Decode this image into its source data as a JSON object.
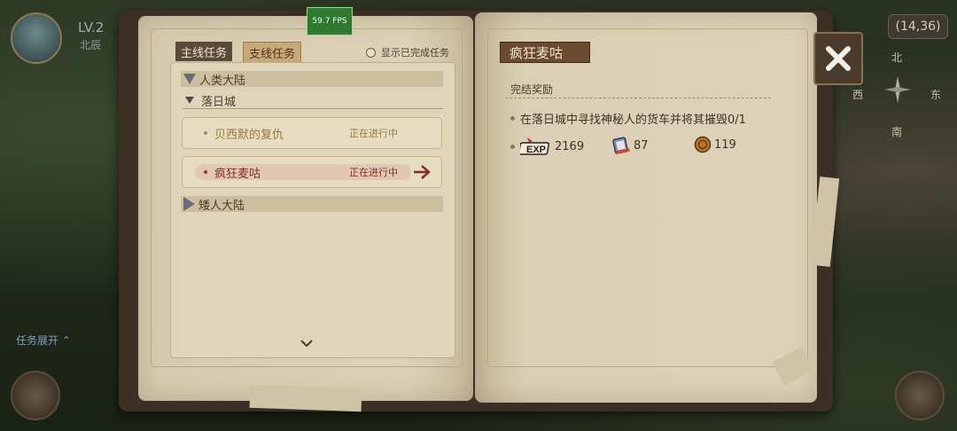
{
  "hud": {
    "level": "LV.2",
    "location": "北辰",
    "coords": "(14,36)",
    "compass": {
      "n": "北",
      "w": "西",
      "e": "东",
      "s": "南"
    },
    "tasks_toggle": "任务展开",
    "fps": "59.7 FPS"
  },
  "left_page": {
    "tabs": [
      {
        "label": "主线任务",
        "active": true
      },
      {
        "label": "支线任务",
        "active": false
      }
    ],
    "show_completed": "显示已完成任务",
    "regions": [
      {
        "name": "人类大陆",
        "expanded": true
      },
      {
        "name": "矮人大陆",
        "expanded": false
      }
    ],
    "city": "落日城",
    "quests": [
      {
        "name": "贝西默的复仇",
        "status": "正在进行中",
        "selected": false
      },
      {
        "name": "疯狂麦咕",
        "status": "正在进行中",
        "selected": true
      }
    ]
  },
  "right_page": {
    "quest_title": "疯狂麦咕",
    "reward_heading": "完结奖励",
    "objective": "在落日城中寻找神秘人的货车并将其摧毁0/1",
    "rewards": [
      {
        "icon": "exp-icon",
        "label": "EXP",
        "value": "2169"
      },
      {
        "icon": "book-icon",
        "value": "87"
      },
      {
        "icon": "coin-icon",
        "value": "119"
      }
    ]
  },
  "colors": {
    "page": "#d8cdb2",
    "title_bg": "#6c4a30",
    "active_quest": "#7a3028",
    "quest_text": "#9a7a3a"
  }
}
